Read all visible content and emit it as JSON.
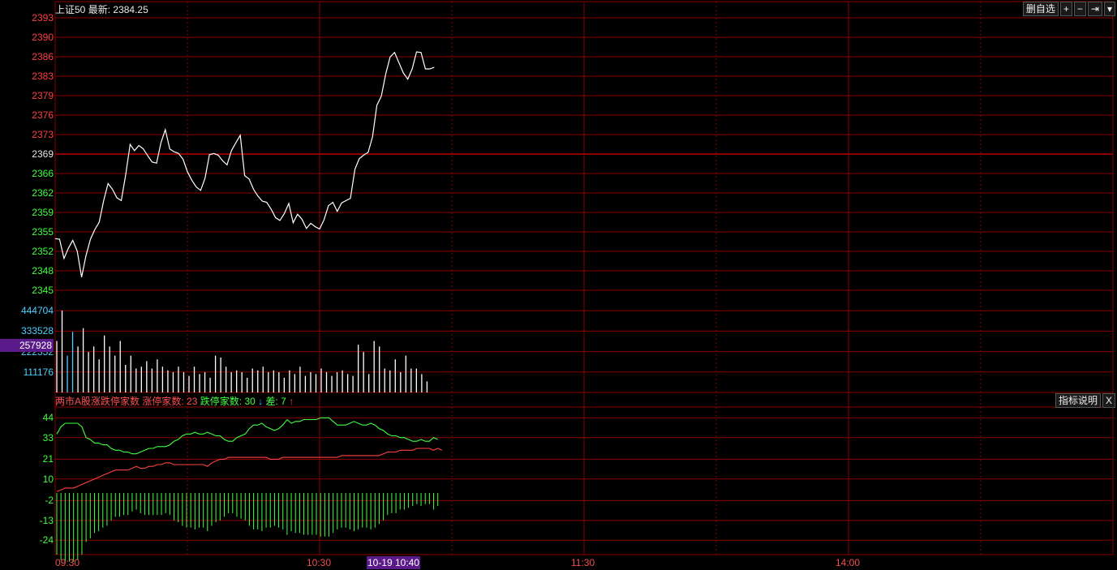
{
  "header": {
    "index_name": "上证50",
    "latest_label": "最新:",
    "latest_value": "2384.25"
  },
  "toolbar": {
    "delete_label": "删自选",
    "plus_label": "+",
    "minus_label": "−",
    "end_label": "⇥",
    "menu_label": "▾"
  },
  "breadth": {
    "title": "两市A股涨跌停家数",
    "up_label": "涨停家数:",
    "up_value": "23",
    "down_label": "跌停家数:",
    "down_value": "30",
    "diff_label": "差:",
    "diff_value": "7",
    "explain_label": "指标说明",
    "close_label": "X"
  },
  "cursor": {
    "time_label": "10-19 10:40",
    "volume_label": "257928"
  },
  "colors": {
    "grid": "#8b0000",
    "price_line": "#ffffff",
    "up": "#ff4040",
    "down": "#40ff40",
    "volume": "#ffffff",
    "axis_blue": "#4dd0ff"
  },
  "chart_data": [
    {
      "type": "line",
      "name": "price",
      "y_ticks_up": [
        "2393",
        "2390",
        "2386",
        "2383",
        "2379",
        "2376",
        "2373"
      ],
      "y_tick_mid": "2369",
      "y_ticks_down": [
        "2366",
        "2362",
        "2359",
        "2355",
        "2352",
        "2348",
        "2345"
      ],
      "ylim": [
        2345,
        2393
      ],
      "x_ticks": [
        "09:30",
        "10:30",
        "11:30",
        "14:00"
      ],
      "values": [
        2354.1,
        2354.0,
        2350.6,
        2352.4,
        2353.8,
        2351.9,
        2347.3,
        2351.1,
        2354.0,
        2355.7,
        2357.0,
        2360.8,
        2363.8,
        2362.8,
        2361.3,
        2360.8,
        2365.3,
        2370.7,
        2369.6,
        2370.5,
        2369.9,
        2368.7,
        2367.6,
        2367.4,
        2371.0,
        2373.3,
        2369.9,
        2369.4,
        2369.1,
        2368.1,
        2365.9,
        2364.4,
        2363.2,
        2362.6,
        2364.7,
        2368.9,
        2369.1,
        2368.8,
        2367.8,
        2367.1,
        2369.6,
        2371.0,
        2372.3,
        2365.2,
        2364.6,
        2362.8,
        2361.6,
        2360.7,
        2360.5,
        2359.3,
        2357.8,
        2357.3,
        2358.5,
        2360.3,
        2356.9,
        2358.4,
        2357.5,
        2355.9,
        2356.8,
        2356.2,
        2355.8,
        2357.4,
        2359.9,
        2360.5,
        2358.9,
        2360.4,
        2360.8,
        2361.2,
        2366.3,
        2368.2,
        2368.8,
        2369.3,
        2372.0,
        2377.6,
        2379.2,
        2383.1,
        2386.1,
        2386.9,
        2385.1,
        2383.3,
        2382.2,
        2384.0,
        2387.0,
        2386.9,
        2384.0,
        2384.0,
        2384.3
      ]
    },
    {
      "type": "bar",
      "name": "volume",
      "y_ticks": [
        "444704",
        "333528",
        "222352",
        "111176"
      ],
      "ylim": [
        0,
        555880
      ],
      "values": [
        280000,
        445000,
        200000,
        330000,
        250000,
        350000,
        220000,
        250000,
        180000,
        310000,
        250000,
        200000,
        280000,
        150000,
        200000,
        130000,
        140000,
        170000,
        130000,
        180000,
        140000,
        120000,
        110000,
        140000,
        110000,
        90000,
        140000,
        100000,
        110000,
        80000,
        200000,
        190000,
        140000,
        110000,
        120000,
        110000,
        80000,
        130000,
        120000,
        140000,
        110000,
        120000,
        110000,
        80000,
        120000,
        100000,
        140000,
        90000,
        110000,
        100000,
        130000,
        110000,
        90000,
        110000,
        120000,
        100000,
        90000,
        260000,
        220000,
        100000,
        280000,
        250000,
        130000,
        120000,
        180000,
        110000,
        200000,
        130000,
        130000,
        100000,
        60000
      ]
    },
    {
      "type": "line",
      "name": "breadth",
      "y_ticks": [
        "44",
        "33",
        "21",
        "10",
        "-2",
        "-13",
        "-24"
      ],
      "ylim": [
        -32,
        50
      ],
      "up_counts": [
        3,
        4,
        5,
        5,
        5,
        6,
        7,
        8,
        9,
        10,
        11,
        12,
        13,
        14,
        15,
        15,
        15,
        15,
        16,
        17,
        16,
        16,
        17,
        17,
        18,
        18,
        19,
        19,
        18,
        18,
        18,
        18,
        18,
        18,
        18,
        18,
        17,
        19,
        20,
        21,
        21,
        22,
        22,
        22,
        22,
        22,
        22,
        22,
        22,
        22,
        22,
        21,
        21,
        21,
        22,
        22,
        22,
        22,
        22,
        22,
        22,
        22,
        22,
        22,
        22,
        22,
        22,
        22,
        23,
        23,
        23,
        23,
        23,
        23,
        23,
        23,
        23,
        23,
        24,
        25,
        25,
        25,
        26,
        26,
        26,
        26,
        27,
        27,
        27,
        27,
        26,
        27,
        26
      ],
      "down_counts": [
        35,
        39,
        41,
        41,
        41,
        41,
        39,
        33,
        32,
        30,
        30,
        29,
        29,
        27,
        26,
        26,
        25,
        25,
        24,
        24,
        25,
        26,
        27,
        27,
        28,
        28,
        28,
        29,
        31,
        32,
        34,
        35,
        35,
        36,
        35,
        35,
        36,
        35,
        34,
        34,
        32,
        31,
        31,
        33,
        34,
        35,
        38,
        40,
        40,
        41,
        39,
        38,
        37,
        38,
        40,
        43,
        41,
        42,
        42,
        43,
        43,
        43,
        43,
        44,
        44,
        44,
        42,
        40,
        40,
        40,
        41,
        42,
        41,
        40,
        40,
        41,
        40,
        38,
        37,
        35,
        34,
        34,
        33,
        33,
        32,
        31,
        31,
        32,
        31,
        31,
        33,
        32
      ],
      "diff_values": [
        -32,
        -35,
        -36,
        -36,
        -36,
        -35,
        -32,
        -25,
        -23,
        -20,
        -19,
        -17,
        -16,
        -13,
        -11,
        -11,
        -10,
        -10,
        -8,
        -7,
        -9,
        -10,
        -10,
        -10,
        -10,
        -10,
        -9,
        -10,
        -13,
        -14,
        -16,
        -17,
        -17,
        -18,
        -17,
        -17,
        -19,
        -16,
        -14,
        -13,
        -11,
        -9,
        -9,
        -11,
        -12,
        -13,
        -16,
        -18,
        -18,
        -19,
        -17,
        -17,
        -16,
        -17,
        -18,
        -21,
        -19,
        -20,
        -20,
        -21,
        -21,
        -21,
        -21,
        -22,
        -22,
        -22,
        -20,
        -18,
        -17,
        -17,
        -18,
        -19,
        -18,
        -17,
        -17,
        -18,
        -17,
        -15,
        -13,
        -10,
        -9,
        -9,
        -7,
        -7,
        -6,
        -5,
        -4,
        -5,
        -4,
        -4,
        -7,
        -5
      ]
    }
  ]
}
